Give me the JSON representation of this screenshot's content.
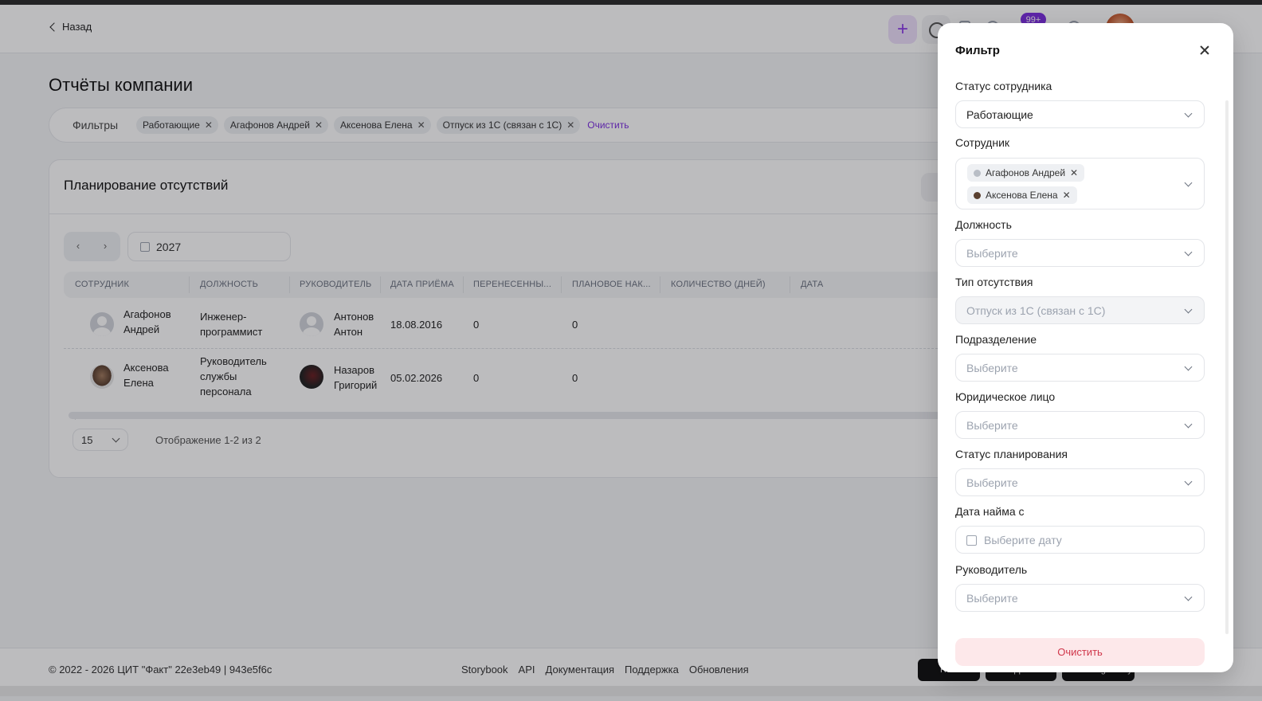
{
  "header": {
    "back_label": "Назад",
    "badge": "99+"
  },
  "page": {
    "title": "Отчёты компании"
  },
  "filters_bar": {
    "label": "Фильтры",
    "chips": [
      "Работающие",
      "Агафонов Андрей",
      "Аксенова Елена",
      "Отпуск из 1С (связан с 1С)"
    ],
    "clear_label": "Очистить"
  },
  "report": {
    "title": "Планирование отсутствий",
    "year": "2027",
    "columns": [
      "Сотрудник",
      "Должность",
      "Руководитель",
      "Дата приёма",
      "Перенесенны...",
      "Плановое нак...",
      "Количество (дней)",
      "Дата"
    ],
    "rows": [
      {
        "employee": [
          "Агафонов",
          "Андрей"
        ],
        "position": [
          "Инженер-",
          "программист"
        ],
        "manager": [
          "Антонов",
          "Антон"
        ],
        "hire_date": "18.08.2016",
        "carried": "0",
        "planned": "0"
      },
      {
        "employee": [
          "Аксенова",
          "Елена"
        ],
        "position": [
          "Руководитель",
          "службы",
          "персонала"
        ],
        "manager": [
          "Назаров",
          "Григорий"
        ],
        "hire_date": "05.02.2026",
        "carried": "0",
        "planned": "0"
      }
    ],
    "per_page": "15",
    "showing": "Отображение 1-2 из 2"
  },
  "footer": {
    "copyright": "© 2022 - 2026 ЦИТ \"Факт\"  22e3eb49 | 943e5f6c",
    "links": [
      "Storybook",
      "API",
      "Документация",
      "Поддержка",
      "Обновления"
    ],
    "stores": [
      "RuStore",
      "AppStore",
      "Google Play"
    ]
  },
  "filter_drawer": {
    "title": "Фильтр",
    "employee_status": {
      "label": "Статус сотрудника",
      "value": "Работающие"
    },
    "employee": {
      "label": "Сотрудник",
      "selected": [
        "Агафонов Андрей",
        "Аксенова Елена"
      ]
    },
    "position": {
      "label": "Должность",
      "placeholder": "Выберите"
    },
    "absence_type": {
      "label": "Тип отсутствия",
      "value": "Отпуск из 1С (связан с 1С)"
    },
    "department": {
      "label": "Подразделение",
      "placeholder": "Выберите"
    },
    "legal_entity": {
      "label": "Юридическое лицо",
      "placeholder": "Выберите"
    },
    "planning_status": {
      "label": "Статус планирования",
      "placeholder": "Выберите"
    },
    "hire_date_from": {
      "label": "Дата найма с",
      "placeholder": "Выберите дату"
    },
    "manager": {
      "label": "Руководитель",
      "placeholder": "Выберите"
    },
    "clear_label": "Очистить"
  }
}
